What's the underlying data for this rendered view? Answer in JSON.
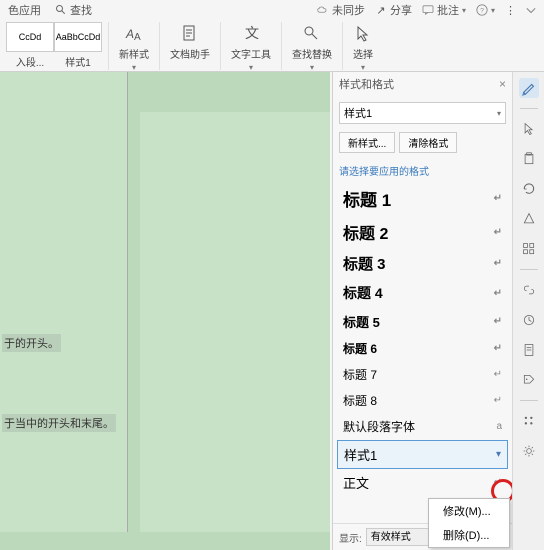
{
  "topbar": {
    "left": {
      "app_label": "色应用",
      "find_label": "查找"
    },
    "right": {
      "sync": "未同步",
      "share": "分享",
      "comment": "批注"
    }
  },
  "ribbon": {
    "sample1_text": "CcDd",
    "sample1_label": "入段...",
    "sample2_text": "AaBbCcDd",
    "sample2_label": "样式1",
    "new_style": "新样式",
    "doc_helper": "文档助手",
    "text_tools": "文字工具",
    "find_replace": "查找替换",
    "select": "选择"
  },
  "doc": {
    "line1": "于的开头。",
    "line2": "于当中的开头和末尾。"
  },
  "panel": {
    "title": "样式和格式",
    "current_style": "样式1",
    "new_btn": "新样式...",
    "clear_btn": "清除格式",
    "hint": "请选择要应用的格式",
    "styles": [
      {
        "label": "标题 1",
        "cls": "h1"
      },
      {
        "label": "标题 2",
        "cls": "h2"
      },
      {
        "label": "标题 3",
        "cls": "h3"
      },
      {
        "label": "标题 4",
        "cls": "h4"
      },
      {
        "label": "标题 5",
        "cls": "h5"
      },
      {
        "label": "标题 6",
        "cls": "h6"
      },
      {
        "label": "标题 7",
        "cls": "h7"
      },
      {
        "label": "标题 8",
        "cls": "h8"
      },
      {
        "label": "默认段落字体",
        "cls": "default",
        "mark": "a"
      },
      {
        "label": "样式1",
        "cls": "selected",
        "dropdown": true
      },
      {
        "label": "正文",
        "cls": "body"
      }
    ],
    "footer_label": "显示:",
    "footer_select": "有效样式"
  },
  "context_menu": {
    "modify": "修改(M)...",
    "delete": "删除(D)..."
  }
}
